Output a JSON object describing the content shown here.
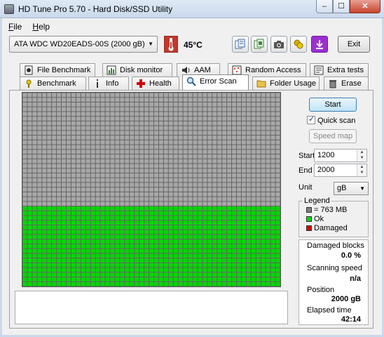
{
  "window": {
    "title": "HD Tune Pro 5.70 - Hard Disk/SSD Utility",
    "min_glyph": "‒",
    "max_glyph": "☐",
    "close_glyph": "✕"
  },
  "menu": [
    {
      "label": "File",
      "key": "F",
      "rest": "ile"
    },
    {
      "label": "Help",
      "key": "H",
      "rest": "elp"
    }
  ],
  "toolbar": {
    "drive": "ATA     WDC WD20EADS-00S (2000 gB)",
    "temperature": "45°C",
    "icons": [
      "copy-info-icon",
      "copy-screen-icon",
      "camera-icon",
      "tools-icon",
      "download-icon"
    ],
    "exit_label": "Exit"
  },
  "tabs_top": [
    {
      "label": "File Benchmark",
      "icon": "file-benchmark-icon"
    },
    {
      "label": "Disk monitor",
      "icon": "disk-monitor-icon"
    },
    {
      "label": "AAM",
      "icon": "speaker-icon"
    },
    {
      "label": "Random Access",
      "icon": "random-access-icon"
    },
    {
      "label": "Extra tests",
      "icon": "extra-tests-icon"
    }
  ],
  "tabs_bottom": [
    {
      "label": "Benchmark",
      "icon": "benchmark-icon"
    },
    {
      "label": "Info",
      "icon": "info-icon"
    },
    {
      "label": "Health",
      "icon": "health-cross-icon"
    },
    {
      "label": "Error Scan",
      "icon": "magnifier-icon",
      "active": true
    },
    {
      "label": "Folder Usage",
      "icon": "folder-icon"
    },
    {
      "label": "Erase",
      "icon": "trash-icon"
    }
  ],
  "scan": {
    "start_button": "Start",
    "quick_scan_label": "Quick scan",
    "quick_scan_checked": true,
    "speed_map_button": "Speed map",
    "start_label": "Start",
    "start_value": "1200",
    "end_label": "End",
    "end_value": "2000",
    "unit_label": "Unit",
    "unit_value": "gB",
    "grid_total_rows": 41,
    "grid_ok_rows": 17,
    "grid_cols": 53
  },
  "legend": {
    "title": "Legend",
    "items": [
      {
        "label": "= 763 MB",
        "color": "#808080"
      },
      {
        "label": "Ok",
        "color": "#00d800"
      },
      {
        "label": "Damaged",
        "color": "#d80000"
      }
    ]
  },
  "stats": {
    "damaged_blocks_label": "Damaged blocks",
    "damaged_blocks_value": "0.0 %",
    "scanning_speed_label": "Scanning speed",
    "scanning_speed_value": "n/a",
    "position_label": "Position",
    "position_value": "2000 gB",
    "elapsed_label": "Elapsed time",
    "elapsed_value": "42:14"
  },
  "colors": {
    "untested": "#a8a8a8",
    "ok": "#00d800",
    "grid_line": "#5a5a5a",
    "accent": "#3c7fb1"
  }
}
